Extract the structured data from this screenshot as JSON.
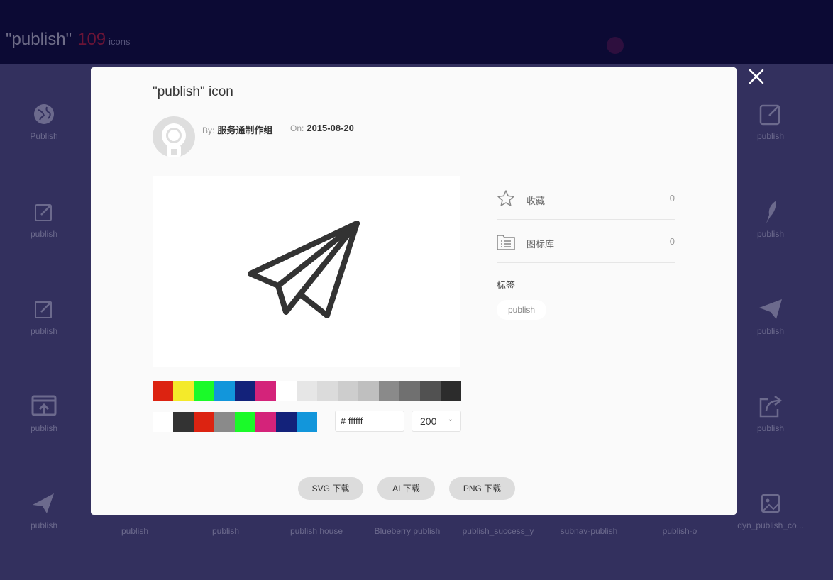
{
  "header": {
    "query": "\"publish\"",
    "count": "109",
    "unit": "icons"
  },
  "grid": {
    "left_column": [
      {
        "label": "Publish",
        "icon": "globe-icon"
      },
      {
        "label": "publish",
        "icon": "edit-square-icon"
      },
      {
        "label": "publish",
        "icon": "edit-square-icon"
      },
      {
        "label": "publish",
        "icon": "upload-window-icon"
      },
      {
        "label": "publish",
        "icon": "paper-plane-solid-icon"
      }
    ],
    "right_column": [
      {
        "label": "publish",
        "icon": "edit-square-icon"
      },
      {
        "label": "publish",
        "icon": "feather-icon"
      },
      {
        "label": "publish",
        "icon": "paper-plane-solid-icon"
      },
      {
        "label": "publish",
        "icon": "share-box-icon"
      },
      {
        "label": "dyn_publish_co...",
        "icon": "image-frame-icon"
      }
    ],
    "bottom_row": [
      "publish",
      "publish",
      "publish house",
      "Blueberry publish",
      "publish_success_y",
      "subnav-publish",
      "publish-o"
    ]
  },
  "modal": {
    "title": "\"publish\" icon",
    "by_label": "By:",
    "author": "服务通制作组",
    "on_label": "On:",
    "date": "2015-08-20",
    "icon": "paper-plane-outline-icon",
    "preset_colors": [
      "#dc2311",
      "#f4ea2a",
      "#1afa29",
      "#1296db",
      "#13227a",
      "#d4237a",
      "#ffffff",
      "#e6e6e6",
      "#dbdbdb",
      "#cdcdcd",
      "#bfbfbf",
      "#8a8a8a",
      "#707070",
      "#515151",
      "#2c2c2c"
    ],
    "recent_colors": [
      "#ffffff",
      "#333333",
      "#dc2311",
      "#8a8a8a",
      "#1afa29",
      "#d4237a",
      "#13227a",
      "#1296db"
    ],
    "hex_value": "# ffffff",
    "size_value": "200",
    "favorites_label": "收藏",
    "favorites_count": "0",
    "library_label": "图标库",
    "library_count": "0",
    "tags_title": "标签",
    "tags": [
      "publish"
    ],
    "buttons": {
      "svg": "SVG 下载",
      "ai": "AI 下载",
      "png": "PNG 下载"
    }
  }
}
